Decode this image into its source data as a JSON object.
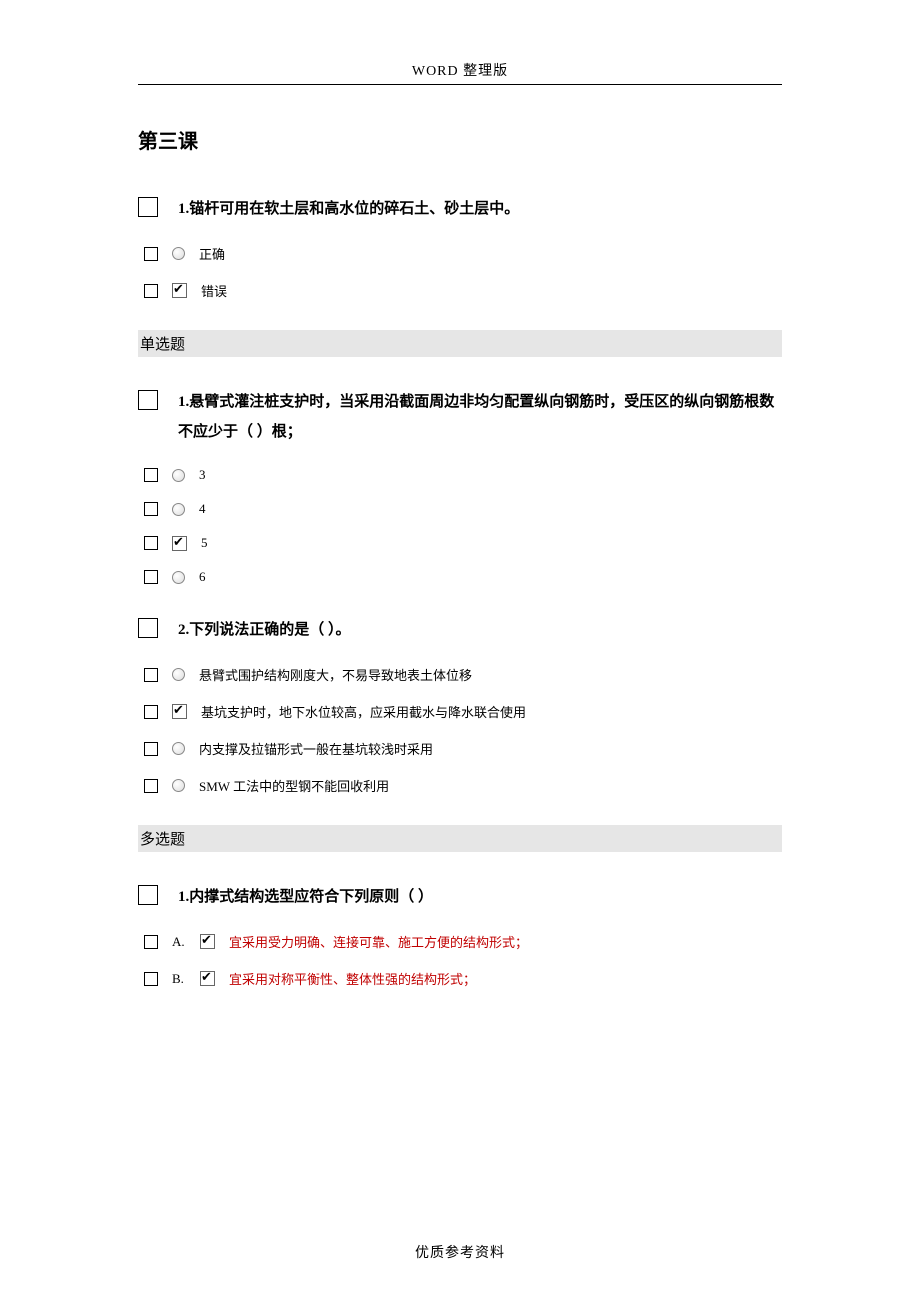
{
  "header": "WORD 整理版",
  "footer": "优质参考资料",
  "lesson_title": "第三课",
  "tf_q1": {
    "text": "1.锚杆可用在软土层和高水位的碎石土、砂土层中。",
    "opt_true": "正确",
    "opt_false": "错误"
  },
  "section_single": "单选题",
  "sc_q1": {
    "text": "1.悬臂式灌注桩支护时，当采用沿截面周边非均匀配置纵向钢筋时，受压区的纵向钢筋根数不应少于（ ）根；",
    "a": "3",
    "b": "4",
    "c": "5",
    "d": "6"
  },
  "sc_q2": {
    "text": "2.下列说法正确的是（ ）。",
    "a": "悬臂式围护结构刚度大，不易导致地表土体位移",
    "b": "基坑支护时，地下水位较高，应采用截水与降水联合使用",
    "c": "内支撑及拉锚形式一般在基坑较浅时采用",
    "d": "SMW 工法中的型钢不能回收利用"
  },
  "section_multi": "多选题",
  "mc_q1": {
    "text": "1.内撑式结构选型应符合下列原则（ ）",
    "la": "A.",
    "lb": "B.",
    "a": "宜采用受力明确、连接可靠、施工方便的结构形式；",
    "b": "宜采用对称平衡性、整体性强的结构形式；"
  }
}
